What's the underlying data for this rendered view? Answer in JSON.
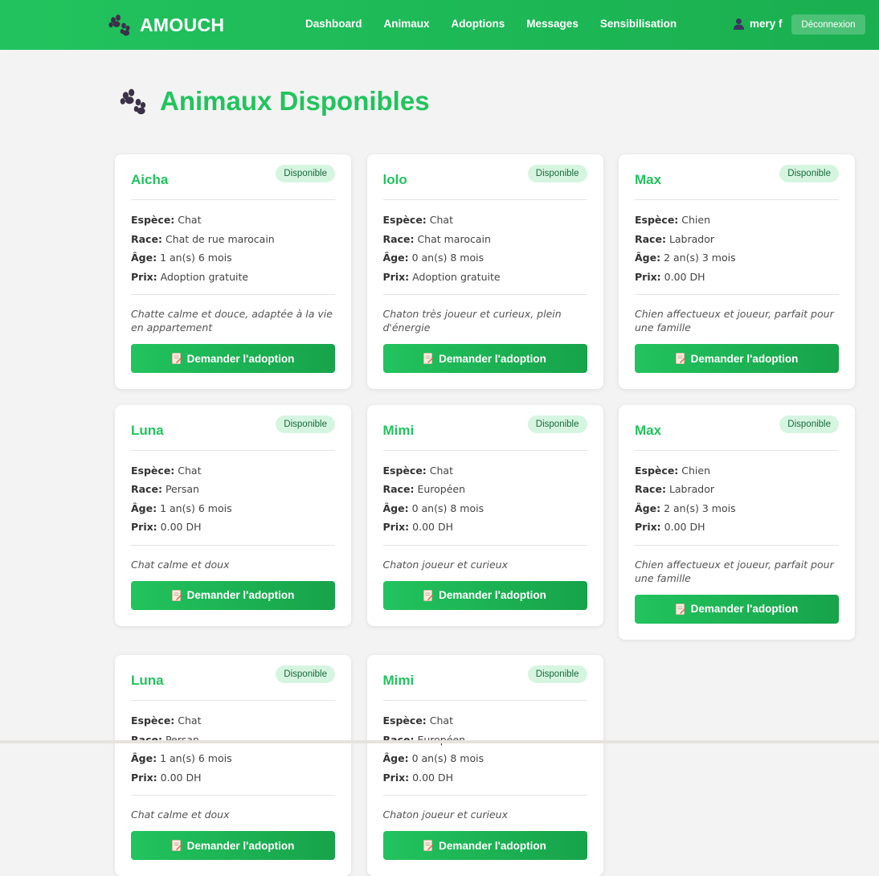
{
  "app": {
    "brand": "AMOUCH"
  },
  "nav": {
    "links": [
      "Dashboard",
      "Animaux",
      "Adoptions",
      "Messages",
      "Sensibilisation"
    ],
    "user": "mery f",
    "logout": "Déconnexion"
  },
  "page": {
    "title": "Animaux Disponibles"
  },
  "labels": {
    "espece": "Espèce:",
    "race": "Race:",
    "age": "Âge:",
    "prix": "Prix:"
  },
  "colors": {
    "brand": "#22c35e",
    "badge_bg": "#d6f5e1",
    "background": "#f3f3f3"
  },
  "icons": {
    "brand": "paw-icon",
    "title": "paw-icon",
    "user": "user-icon",
    "button": "memo-icon"
  },
  "animals": [
    {
      "name": "Aicha",
      "status": "Disponible",
      "espece": "Chat",
      "race": "Chat de rue marocain",
      "age": "1 an(s) 6 mois",
      "prix": "Adoption gratuite",
      "description": "Chatte calme et douce, adaptée à la vie en appartement",
      "action": "Demander l'adoption"
    },
    {
      "name": "lolo",
      "status": "Disponible",
      "espece": "Chat",
      "race": "Chat marocain",
      "age": "0 an(s) 8 mois",
      "prix": "Adoption gratuite",
      "description": "Chaton très joueur et curieux, plein d'énergie",
      "action": "Demander l'adoption"
    },
    {
      "name": "Max",
      "status": "Disponible",
      "espece": "Chien",
      "race": "Labrador",
      "age": "2 an(s) 3 mois",
      "prix": "0.00 DH",
      "description": "Chien affectueux et joueur, parfait pour une famille",
      "action": "Demander l'adoption"
    },
    {
      "name": "Luna",
      "status": "Disponible",
      "espece": "Chat",
      "race": "Persan",
      "age": "1 an(s) 6 mois",
      "prix": "0.00 DH",
      "description": "Chat calme et doux",
      "action": "Demander l'adoption"
    },
    {
      "name": "Mimi",
      "status": "Disponible",
      "espece": "Chat",
      "race": "Européen",
      "age": "0 an(s) 8 mois",
      "prix": "0.00 DH",
      "description": "Chaton joueur et curieux",
      "action": "Demander l'adoption"
    },
    {
      "name": "Max",
      "status": "Disponible",
      "espece": "Chien",
      "race": "Labrador",
      "age": "2 an(s) 3 mois",
      "prix": "0.00 DH",
      "description": "Chien affectueux et joueur, parfait pour une famille",
      "action": "Demander l'adoption"
    },
    {
      "name": "Luna",
      "status": "Disponible",
      "espece": "Chat",
      "race": "Persan",
      "age": "1 an(s) 6 mois",
      "prix": "0.00 DH",
      "description": "Chat calme et doux",
      "action": "Demander l'adoption"
    },
    {
      "name": "Mimi",
      "status": "Disponible",
      "espece": "Chat",
      "race": "Européen",
      "age": "0 an(s) 8 mois",
      "prix": "0.00 DH",
      "description": "Chaton joueur et curieux",
      "action": "Demander l'adoption"
    }
  ]
}
